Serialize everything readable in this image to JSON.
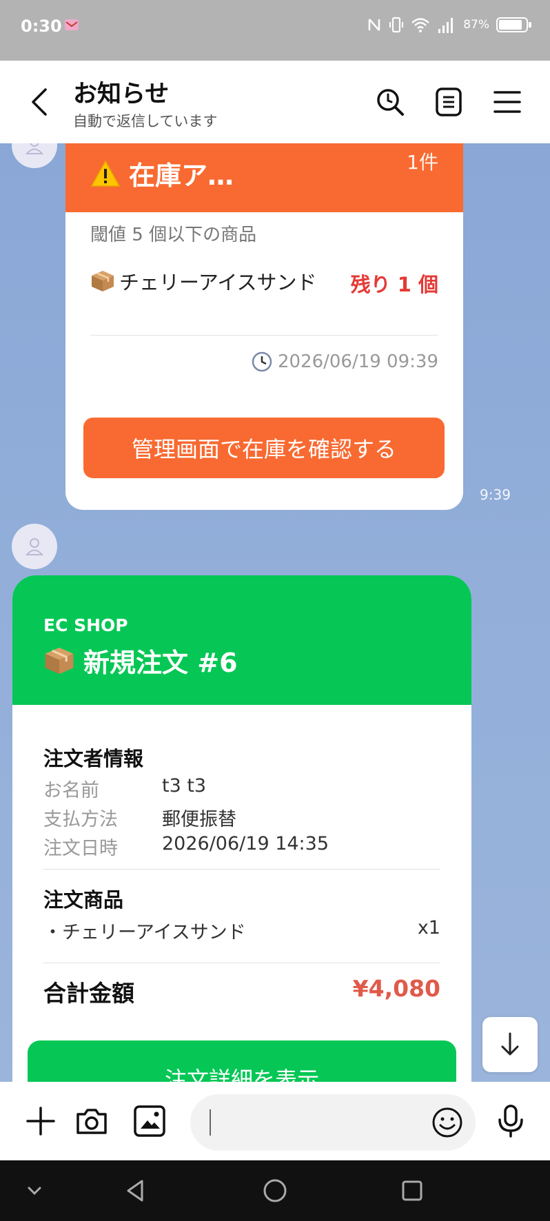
{
  "status_bar": {
    "time": "0:30",
    "battery_text": "87%",
    "battery_level": 0.87
  },
  "header": {
    "title": "お知らせ",
    "subtitle": "自動で返信しています"
  },
  "stock_alert": {
    "title": "在庫ア…",
    "count": "1件",
    "threshold_text": "閾値 5 個以下の商品",
    "item_name": "チェリーアイスサンド",
    "remaining": "残り 1 個",
    "timestamp": "2026/06/19 09:39",
    "button_label": "管理画面で在庫を確認する",
    "message_time": "9:39",
    "header_color": "#f86a31"
  },
  "order": {
    "shop_name": "EC SHOP",
    "title": "新規注文 #6",
    "customer_section": "注文者情報",
    "fields": [
      {
        "label": "お名前",
        "value": "t3 t3"
      },
      {
        "label": "支払方法",
        "value": "郵便振替"
      },
      {
        "label": "注文日時",
        "value": "2026/06/19 14:35"
      }
    ],
    "items_section": "注文商品",
    "items": [
      {
        "name": "・チェリーアイスサンド",
        "qty": "x1"
      }
    ],
    "total_label": "合計金額",
    "total_value": "¥4,080",
    "button_label": "注文詳細を表示",
    "header_color": "#06c755"
  },
  "input_bar": {
    "placeholder": ""
  },
  "icons": [
    "back-icon",
    "search-icon",
    "notes-icon",
    "menu-icon",
    "plus-icon",
    "camera-icon",
    "image-icon",
    "emoji-icon",
    "mic-icon",
    "arrow-down-icon",
    "warning-icon",
    "package-icon",
    "clock-icon",
    "avatar-icon"
  ]
}
